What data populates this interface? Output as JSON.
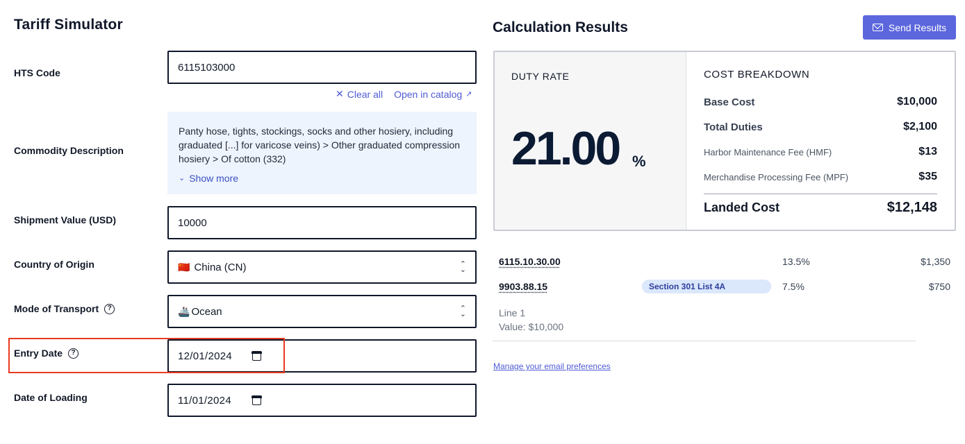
{
  "form": {
    "title": "Tariff Simulator",
    "hts_code": {
      "label": "HTS Code",
      "value": "6115103000"
    },
    "links": {
      "clear_all": "Clear all",
      "open_catalog": "Open in catalog"
    },
    "commodity": {
      "label": "Commodity Description",
      "text": "Panty hose, tights, stockings, socks and other hosiery, including graduated [...] for varicose veins) > Other graduated compression hosiery > Of cotton (332)",
      "show_more": "Show more"
    },
    "shipment_value": {
      "label": "Shipment Value (USD)",
      "value": "10000"
    },
    "country": {
      "label": "Country of Origin",
      "flag": "🇨🇳",
      "value": "China (CN)"
    },
    "transport": {
      "label": "Mode of Transport",
      "icon": "🚢",
      "value": "Ocean"
    },
    "entry_date": {
      "label": "Entry Date",
      "value": "12/01/2024"
    },
    "loading_date": {
      "label": "Date of Loading",
      "value": "11/01/2024"
    }
  },
  "results": {
    "title": "Calculation Results",
    "send_button": "Send Results",
    "duty_rate": {
      "label": "DUTY RATE",
      "value": "21.00",
      "unit": "%"
    },
    "cost_breakdown": {
      "title": "COST BREAKDOWN",
      "rows": [
        {
          "label": "Base Cost",
          "value": "$10,000"
        },
        {
          "label": "Total Duties",
          "value": "$2,100"
        },
        {
          "label": "Harbor Maintenance Fee (HMF)",
          "value": "$13"
        },
        {
          "label": "Merchandise Processing Fee (MPF)",
          "value": "$35"
        }
      ],
      "total": {
        "label": "Landed Cost",
        "value": "$12,148"
      }
    },
    "lines": [
      {
        "code": "6115.10.30.00",
        "badge": "",
        "rate": "13.5%",
        "amount": "$1,350"
      },
      {
        "code": "9903.88.15",
        "badge": "Section 301 List 4A",
        "rate": "7.5%",
        "amount": "$750"
      }
    ],
    "line_meta": {
      "name": "Line 1",
      "value": "Value: $10,000"
    },
    "email_pref": "Manage your email preferences"
  },
  "colors": {
    "accent": "#5c66dd",
    "highlight": "#e8391f",
    "link": "#4f5bd5",
    "badge_bg": "#dbe7fb"
  }
}
